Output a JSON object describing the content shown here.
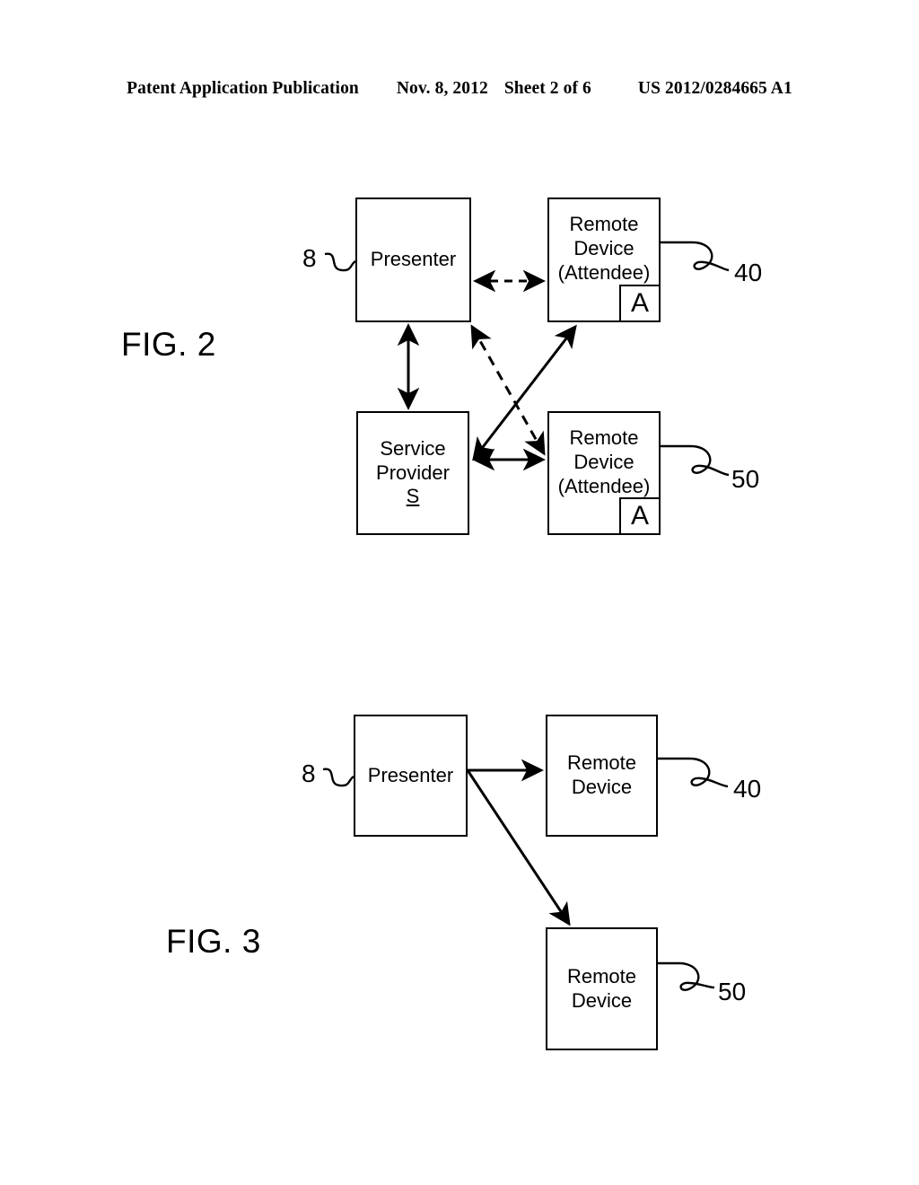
{
  "header": {
    "publication": "Patent Application Publication",
    "date": "Nov. 8, 2012",
    "sheet": "Sheet 2 of 6",
    "patent_number": "US 2012/0284665 A1"
  },
  "figures": [
    {
      "id": "fig2",
      "label": "FIG. 2",
      "nodes": [
        {
          "name": "presenter",
          "lines": [
            "Presenter"
          ],
          "ref": "8"
        },
        {
          "name": "remote-device-40",
          "lines": [
            "Remote",
            "Device",
            "(Attendee)"
          ],
          "badge": "A",
          "ref": "40"
        },
        {
          "name": "service-provider",
          "lines": [
            "Service",
            "Provider",
            "S"
          ],
          "underline_last": true,
          "ref": ""
        },
        {
          "name": "remote-device-50",
          "lines": [
            "Remote",
            "Device",
            "(Attendee)"
          ],
          "badge": "A",
          "ref": "50"
        }
      ],
      "connectors": [
        {
          "name": "presenter-to-remote40",
          "style": "dashed",
          "arrows": "both"
        },
        {
          "name": "presenter-to-service-provider",
          "style": "solid",
          "arrows": "both"
        },
        {
          "name": "service-provider-to-remote50",
          "style": "solid",
          "arrows": "both"
        },
        {
          "name": "service-provider-to-remote40",
          "style": "solid",
          "arrows": "both"
        },
        {
          "name": "presenter-to-remote50",
          "style": "dashed",
          "arrows": "both"
        }
      ]
    },
    {
      "id": "fig3",
      "label": "FIG. 3",
      "nodes": [
        {
          "name": "presenter",
          "lines": [
            "Presenter"
          ],
          "ref": "8"
        },
        {
          "name": "remote-device-40",
          "lines": [
            "Remote",
            "Device"
          ],
          "ref": "40"
        },
        {
          "name": "remote-device-50",
          "lines": [
            "Remote",
            "Device"
          ],
          "ref": "50"
        }
      ],
      "connectors": [
        {
          "name": "presenter-to-remote40",
          "style": "solid",
          "arrows": "single"
        },
        {
          "name": "presenter-to-remote50",
          "style": "solid",
          "arrows": "single"
        }
      ]
    }
  ]
}
